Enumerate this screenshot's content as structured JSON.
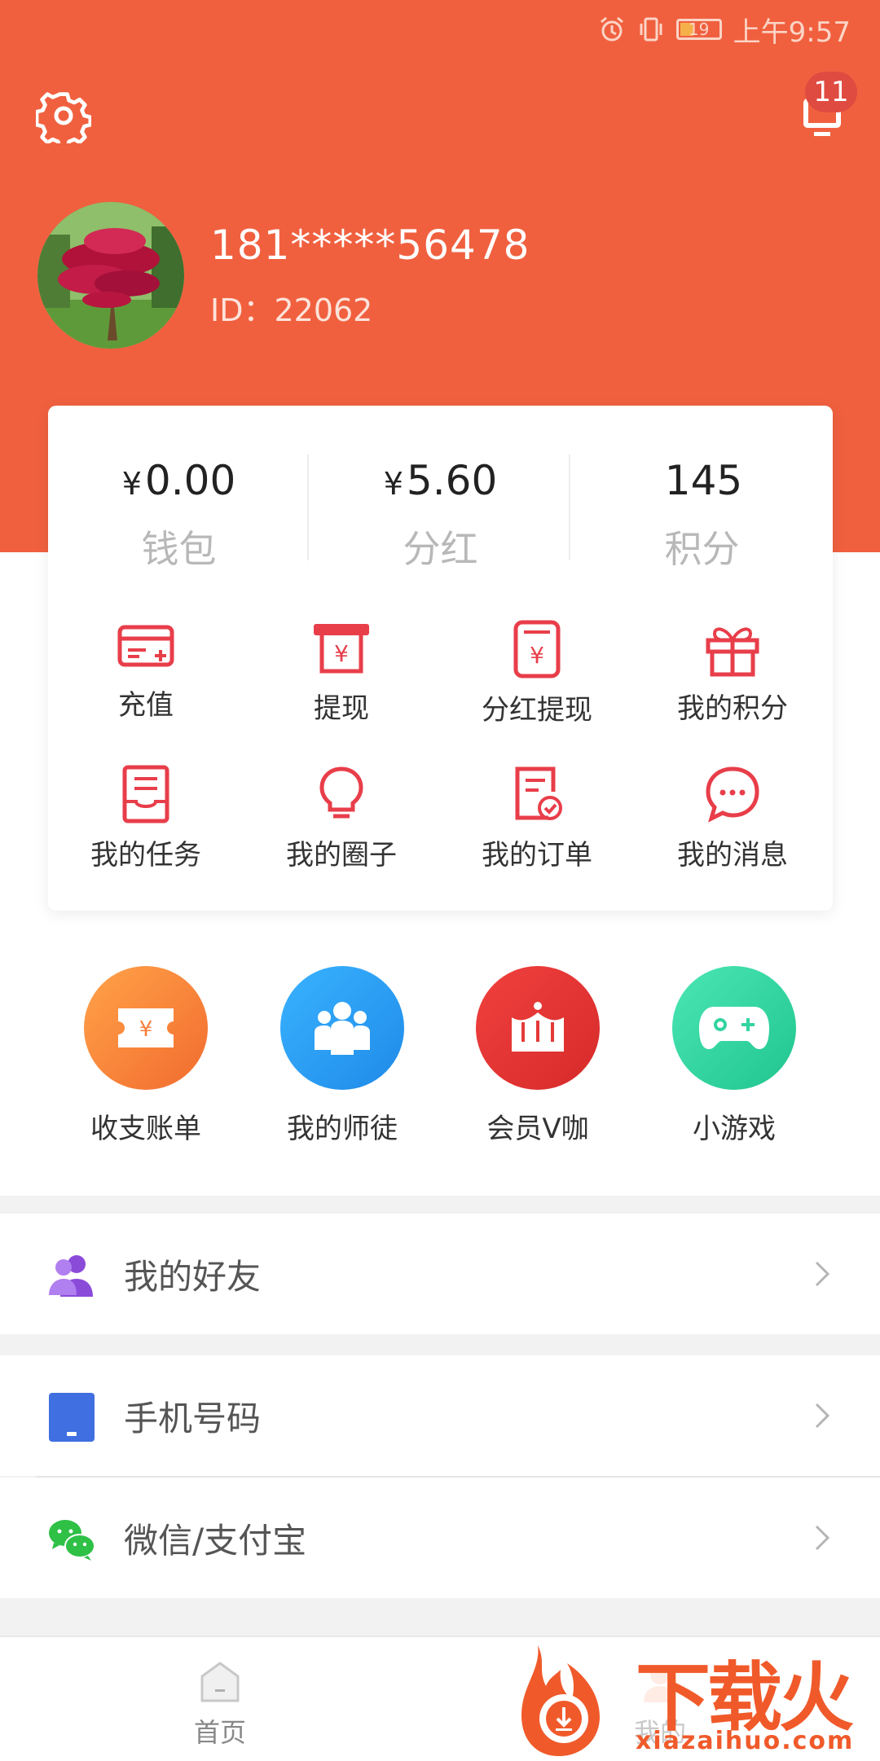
{
  "status": {
    "battery": "19",
    "time": "上午9:57"
  },
  "header": {
    "badge_count": "11"
  },
  "profile": {
    "phone": "181*****56478",
    "id_text": "ID：22062"
  },
  "stats": [
    {
      "currency": "¥",
      "value": "0.00",
      "label": "钱包"
    },
    {
      "currency": "¥",
      "value": "5.60",
      "label": "分红"
    },
    {
      "currency": "",
      "value": "145",
      "label": "积分"
    }
  ],
  "quick_actions": [
    {
      "label": "充值",
      "icon": "card-add-icon"
    },
    {
      "label": "提现",
      "icon": "withdraw-icon"
    },
    {
      "label": "分红提现",
      "icon": "bonus-withdraw-icon"
    },
    {
      "label": "我的积分",
      "icon": "gift-icon"
    },
    {
      "label": "我的任务",
      "icon": "task-icon"
    },
    {
      "label": "我的圈子",
      "icon": "lightbulb-icon"
    },
    {
      "label": "我的订单",
      "icon": "order-icon"
    },
    {
      "label": "我的消息",
      "icon": "chat-bubble-icon"
    }
  ],
  "features": [
    {
      "label": "收支账单",
      "icon": "ticket-icon",
      "color": "#f57e3a"
    },
    {
      "label": "我的师徒",
      "icon": "people-icon",
      "color": "#2a9ff0"
    },
    {
      "label": "会员V咖",
      "icon": "crown-icon",
      "color": "#e43a3a"
    },
    {
      "label": "小游戏",
      "icon": "gamepad-icon",
      "color": "#33d4a0"
    }
  ],
  "list": [
    {
      "label": "我的好友",
      "icon": "friends-icon"
    },
    {
      "label": "手机号码",
      "icon": "phone-icon"
    },
    {
      "label": "微信/支付宝",
      "icon": "wechat-icon"
    }
  ],
  "tabs": [
    {
      "label": "首页",
      "icon": "home-icon"
    },
    {
      "label": "我的",
      "icon": "profile-icon"
    }
  ],
  "watermark": {
    "brand": "下载火",
    "url": "xiazaihuo.com"
  }
}
